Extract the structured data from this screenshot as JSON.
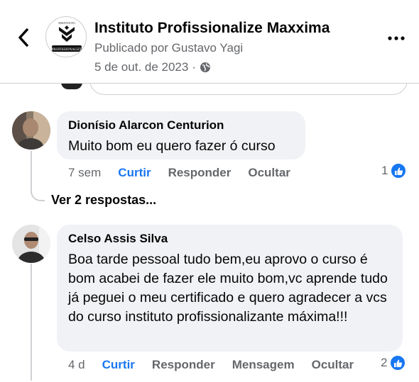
{
  "header": {
    "page_name": "Instituto Profissionalize Maxxima",
    "published_by": "Publicado por Gustavo Yagi",
    "date": "5 de out. de 2023",
    "separator": "·",
    "logo_top_text": "INSTITUTO",
    "logo_bottom_text": "PROFISSIONALIZE"
  },
  "comments": [
    {
      "author": "Dionísio Alarcon Centurion",
      "text": "Muito bom eu quero fazer ó curso",
      "time": "7 sem",
      "actions": [
        "Curtir",
        "Responder",
        "Ocultar"
      ],
      "like_count": "1"
    },
    {
      "author": "Celso Assis Silva",
      "text": "Boa tarde pessoal tudo bem,eu aprovo o curso é bom acabei de fazer ele muito bom,vc aprende tudo já peguei o meu certificado e quero agradecer a vcs do curso instituto profissionalizante máxima!!!",
      "time": "4 d",
      "actions": [
        "Curtir",
        "Responder",
        "Mensagem",
        "Ocultar"
      ],
      "like_count": "2"
    }
  ],
  "view_replies": "Ver 2 respostas...",
  "colors": {
    "accent": "#1877f2",
    "muted": "#65676b",
    "bubble": "#f0f2f5"
  },
  "icons": [
    "back-arrow-icon",
    "more-options-icon",
    "globe-icon",
    "like-icon"
  ]
}
